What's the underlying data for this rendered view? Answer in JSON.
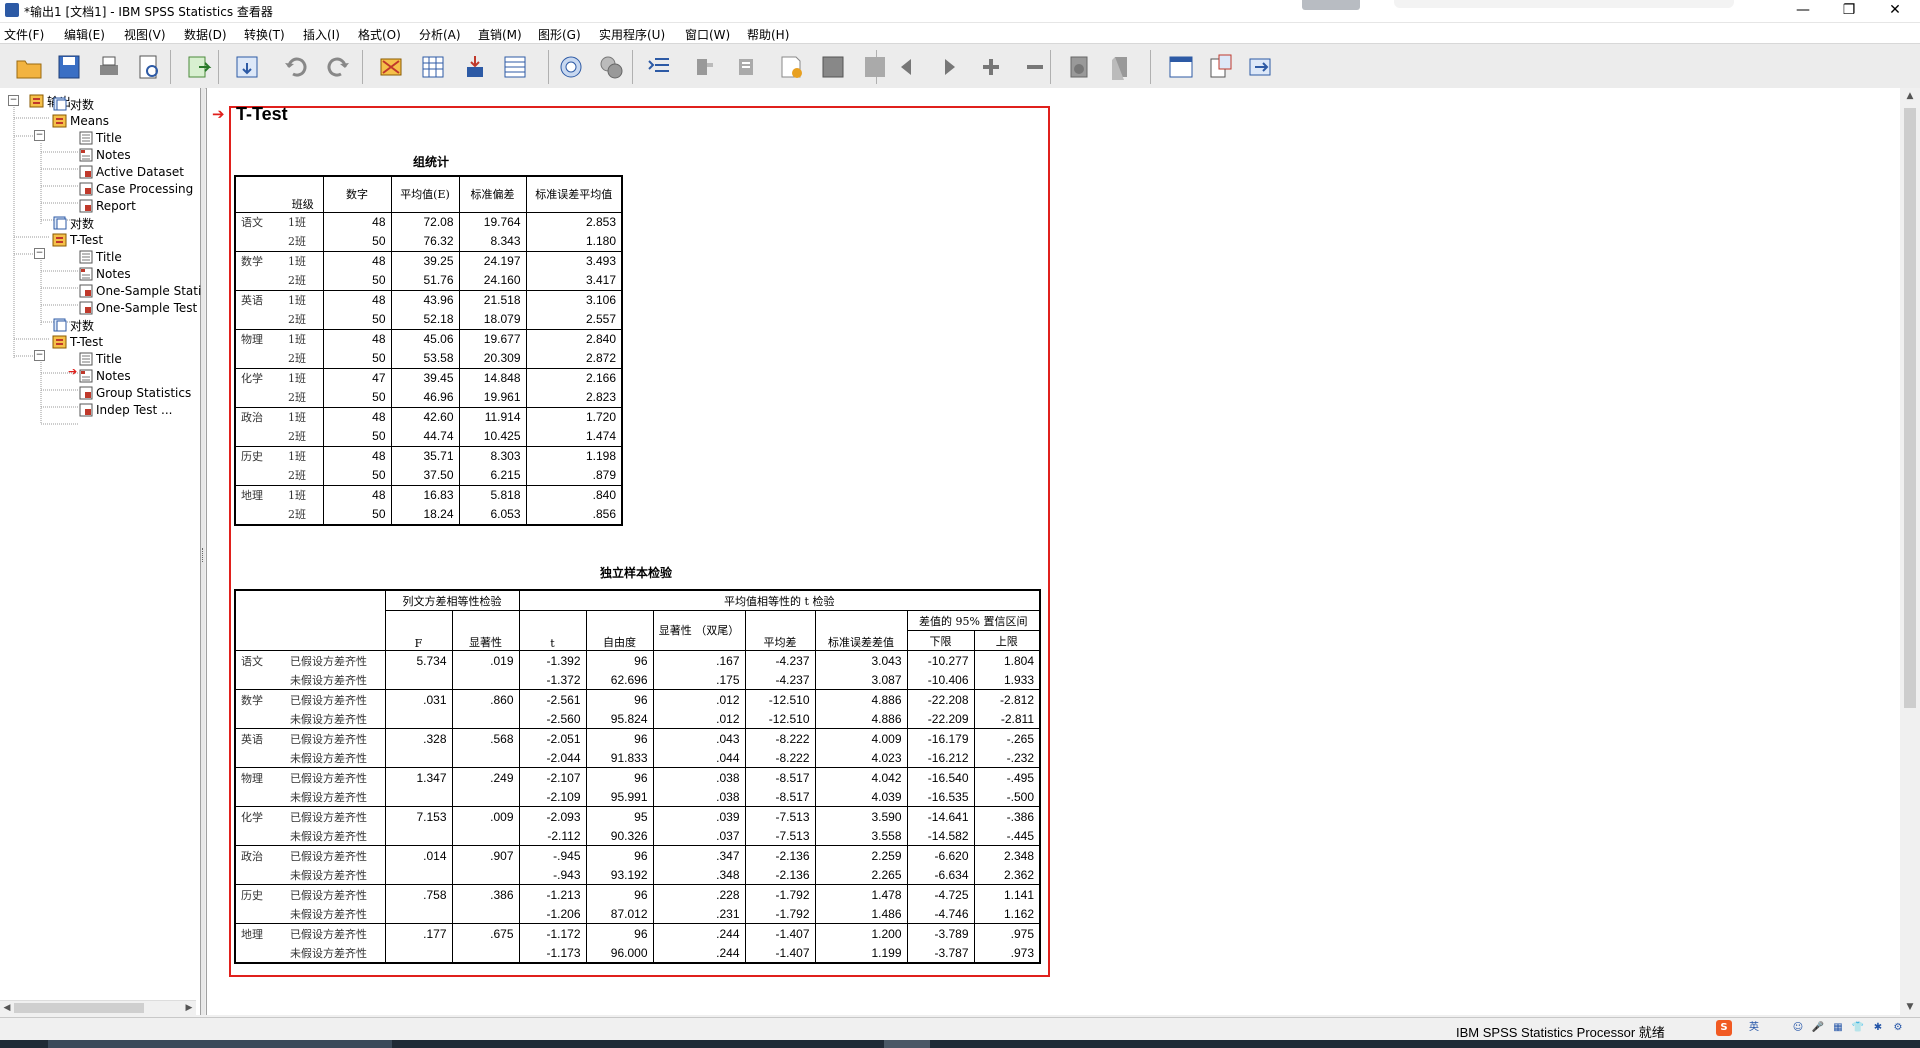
{
  "window": {
    "title": "*输出1 [文档1] - IBM SPSS Statistics 查看器",
    "controls": {
      "minimize": "—",
      "restore": "❐",
      "close": "✕"
    }
  },
  "menu": [
    "文件(F)",
    "编辑(E)",
    "视图(V)",
    "数据(D)",
    "转换(T)",
    "插入(I)",
    "格式(O)",
    "分析(A)",
    "直销(M)",
    "图形(G)",
    "实用程序(U)",
    "窗口(W)",
    "帮助(H)"
  ],
  "toolbar_icons": [
    "open-icon",
    "save-icon",
    "print-icon",
    "print-preview-icon",
    "export-icon",
    "recall-dialog-icon",
    "undo-icon",
    "redo-icon",
    "goto-data-icon",
    "goto-case-icon",
    "goto-variable-icon",
    "variables-icon",
    "designate-window-icon",
    "show-all-icon",
    "expand-icon",
    "collapse-icon",
    "show-icon",
    "hide-icon",
    "promote-icon",
    "demote-icon",
    "back-arrow-icon",
    "forward-arrow-icon",
    "add-icon",
    "remove-icon",
    "insert-heading-icon",
    "insert-title-icon",
    "insert-text-icon",
    "new-output-icon",
    "select-last-output-icon"
  ],
  "tree": {
    "root": "输出",
    "items": [
      {
        "label": "对数"
      },
      {
        "label": "Means"
      },
      {
        "label": "Title"
      },
      {
        "label": "Notes"
      },
      {
        "label": "Active Dataset"
      },
      {
        "label": "Case Processing"
      },
      {
        "label": "Report"
      },
      {
        "label": "对数"
      },
      {
        "label": "T-Test"
      },
      {
        "label": "Title"
      },
      {
        "label": "Notes"
      },
      {
        "label": "One-Sample Stati"
      },
      {
        "label": "One-Sample Test"
      },
      {
        "label": "对数"
      },
      {
        "label": "T-Test"
      },
      {
        "label": "Title"
      },
      {
        "label": "Notes"
      },
      {
        "label": "Group Statistics"
      },
      {
        "label": "Indep Test ..."
      }
    ],
    "selected_marker": "➔"
  },
  "output": {
    "heading": "T-Test",
    "heading_marker": "➔",
    "group_stats": {
      "title": "组统计",
      "headers": {
        "class": "班级",
        "n": "数字",
        "mean": "平均值(E)",
        "sd": "标准偏差",
        "se": "标准误差平均值"
      },
      "rows": [
        {
          "subject": "语文",
          "class": "1班",
          "n": "48",
          "mean": "72.08",
          "sd": "19.764",
          "se": "2.853"
        },
        {
          "subject": "",
          "class": "2班",
          "n": "50",
          "mean": "76.32",
          "sd": "8.343",
          "se": "1.180"
        },
        {
          "subject": "数学",
          "class": "1班",
          "n": "48",
          "mean": "39.25",
          "sd": "24.197",
          "se": "3.493"
        },
        {
          "subject": "",
          "class": "2班",
          "n": "50",
          "mean": "51.76",
          "sd": "24.160",
          "se": "3.417"
        },
        {
          "subject": "英语",
          "class": "1班",
          "n": "48",
          "mean": "43.96",
          "sd": "21.518",
          "se": "3.106"
        },
        {
          "subject": "",
          "class": "2班",
          "n": "50",
          "mean": "52.18",
          "sd": "18.079",
          "se": "2.557"
        },
        {
          "subject": "物理",
          "class": "1班",
          "n": "48",
          "mean": "45.06",
          "sd": "19.677",
          "se": "2.840"
        },
        {
          "subject": "",
          "class": "2班",
          "n": "50",
          "mean": "53.58",
          "sd": "20.309",
          "se": "2.872"
        },
        {
          "subject": "化学",
          "class": "1班",
          "n": "47",
          "mean": "39.45",
          "sd": "14.848",
          "se": "2.166"
        },
        {
          "subject": "",
          "class": "2班",
          "n": "50",
          "mean": "46.96",
          "sd": "19.961",
          "se": "2.823"
        },
        {
          "subject": "政治",
          "class": "1班",
          "n": "48",
          "mean": "42.60",
          "sd": "11.914",
          "se": "1.720"
        },
        {
          "subject": "",
          "class": "2班",
          "n": "50",
          "mean": "44.74",
          "sd": "10.425",
          "se": "1.474"
        },
        {
          "subject": "历史",
          "class": "1班",
          "n": "48",
          "mean": "35.71",
          "sd": "8.303",
          "se": "1.198"
        },
        {
          "subject": "",
          "class": "2班",
          "n": "50",
          "mean": "37.50",
          "sd": "6.215",
          "se": ".879"
        },
        {
          "subject": "地理",
          "class": "1班",
          "n": "48",
          "mean": "16.83",
          "sd": "5.818",
          "se": ".840"
        },
        {
          "subject": "",
          "class": "2班",
          "n": "50",
          "mean": "18.24",
          "sd": "6.053",
          "se": ".856"
        }
      ]
    },
    "indep_test": {
      "title": "独立样本检验",
      "group_levene": "列文方差相等性检验",
      "group_ttest": "平均值相等性的 t 检验",
      "group_ci": "差值的 95% 置信区间",
      "headers": {
        "F": "F",
        "sig": "显著性",
        "t": "t",
        "df": "自由度",
        "sig2": "显著性 （双尾）",
        "md": "平均差",
        "sed": "标准误差差值",
        "lower": "下限",
        "upper": "上限"
      },
      "rows": [
        {
          "subject": "语文",
          "assume": "已假设方差齐性",
          "F": "5.734",
          "sig": ".019",
          "t": "-1.392",
          "df": "96",
          "sig2": ".167",
          "md": "-4.237",
          "sed": "3.043",
          "lower": "-10.277",
          "upper": "1.804"
        },
        {
          "subject": "",
          "assume": "未假设方差齐性",
          "F": "",
          "sig": "",
          "t": "-1.372",
          "df": "62.696",
          "sig2": ".175",
          "md": "-4.237",
          "sed": "3.087",
          "lower": "-10.406",
          "upper": "1.933"
        },
        {
          "subject": "数学",
          "assume": "已假设方差齐性",
          "F": ".031",
          "sig": ".860",
          "t": "-2.561",
          "df": "96",
          "sig2": ".012",
          "md": "-12.510",
          "sed": "4.886",
          "lower": "-22.208",
          "upper": "-2.812"
        },
        {
          "subject": "",
          "assume": "未假设方差齐性",
          "F": "",
          "sig": "",
          "t": "-2.560",
          "df": "95.824",
          "sig2": ".012",
          "md": "-12.510",
          "sed": "4.886",
          "lower": "-22.209",
          "upper": "-2.811"
        },
        {
          "subject": "英语",
          "assume": "已假设方差齐性",
          "F": ".328",
          "sig": ".568",
          "t": "-2.051",
          "df": "96",
          "sig2": ".043",
          "md": "-8.222",
          "sed": "4.009",
          "lower": "-16.179",
          "upper": "-.265"
        },
        {
          "subject": "",
          "assume": "未假设方差齐性",
          "F": "",
          "sig": "",
          "t": "-2.044",
          "df": "91.833",
          "sig2": ".044",
          "md": "-8.222",
          "sed": "4.023",
          "lower": "-16.212",
          "upper": "-.232"
        },
        {
          "subject": "物理",
          "assume": "已假设方差齐性",
          "F": "1.347",
          "sig": ".249",
          "t": "-2.107",
          "df": "96",
          "sig2": ".038",
          "md": "-8.517",
          "sed": "4.042",
          "lower": "-16.540",
          "upper": "-.495"
        },
        {
          "subject": "",
          "assume": "未假设方差齐性",
          "F": "",
          "sig": "",
          "t": "-2.109",
          "df": "95.991",
          "sig2": ".038",
          "md": "-8.517",
          "sed": "4.039",
          "lower": "-16.535",
          "upper": "-.500"
        },
        {
          "subject": "化学",
          "assume": "已假设方差齐性",
          "F": "7.153",
          "sig": ".009",
          "t": "-2.093",
          "df": "95",
          "sig2": ".039",
          "md": "-7.513",
          "sed": "3.590",
          "lower": "-14.641",
          "upper": "-.386"
        },
        {
          "subject": "",
          "assume": "未假设方差齐性",
          "F": "",
          "sig": "",
          "t": "-2.112",
          "df": "90.326",
          "sig2": ".037",
          "md": "-7.513",
          "sed": "3.558",
          "lower": "-14.582",
          "upper": "-.445"
        },
        {
          "subject": "政治",
          "assume": "已假设方差齐性",
          "F": ".014",
          "sig": ".907",
          "t": "-.945",
          "df": "96",
          "sig2": ".347",
          "md": "-2.136",
          "sed": "2.259",
          "lower": "-6.620",
          "upper": "2.348"
        },
        {
          "subject": "",
          "assume": "未假设方差齐性",
          "F": "",
          "sig": "",
          "t": "-.943",
          "df": "93.192",
          "sig2": ".348",
          "md": "-2.136",
          "sed": "2.265",
          "lower": "-6.634",
          "upper": "2.362"
        },
        {
          "subject": "历史",
          "assume": "已假设方差齐性",
          "F": ".758",
          "sig": ".386",
          "t": "-1.213",
          "df": "96",
          "sig2": ".228",
          "md": "-1.792",
          "sed": "1.478",
          "lower": "-4.725",
          "upper": "1.141"
        },
        {
          "subject": "",
          "assume": "未假设方差齐性",
          "F": "",
          "sig": "",
          "t": "-1.206",
          "df": "87.012",
          "sig2": ".231",
          "md": "-1.792",
          "sed": "1.486",
          "lower": "-4.746",
          "upper": "1.162"
        },
        {
          "subject": "地理",
          "assume": "已假设方差齐性",
          "F": ".177",
          "sig": ".675",
          "t": "-1.172",
          "df": "96",
          "sig2": ".244",
          "md": "-1.407",
          "sed": "1.200",
          "lower": "-3.789",
          "upper": ".975"
        },
        {
          "subject": "",
          "assume": "未假设方差齐性",
          "F": "",
          "sig": "",
          "t": "-1.173",
          "df": "96.000",
          "sig2": ".244",
          "md": "-1.407",
          "sed": "1.199",
          "lower": "-3.787",
          "upper": ".973"
        }
      ]
    }
  },
  "status": {
    "text": "IBM SPSS Statistics Processor 就绪",
    "tray": [
      "S",
      "英",
      "☺",
      "🎤",
      "▦",
      "👕",
      "✱",
      "⚙"
    ]
  },
  "colors": {
    "selection_red": "#e0201c",
    "tree_icon_orange": "#e8a020",
    "brand_blue": "#2d5aa5"
  }
}
